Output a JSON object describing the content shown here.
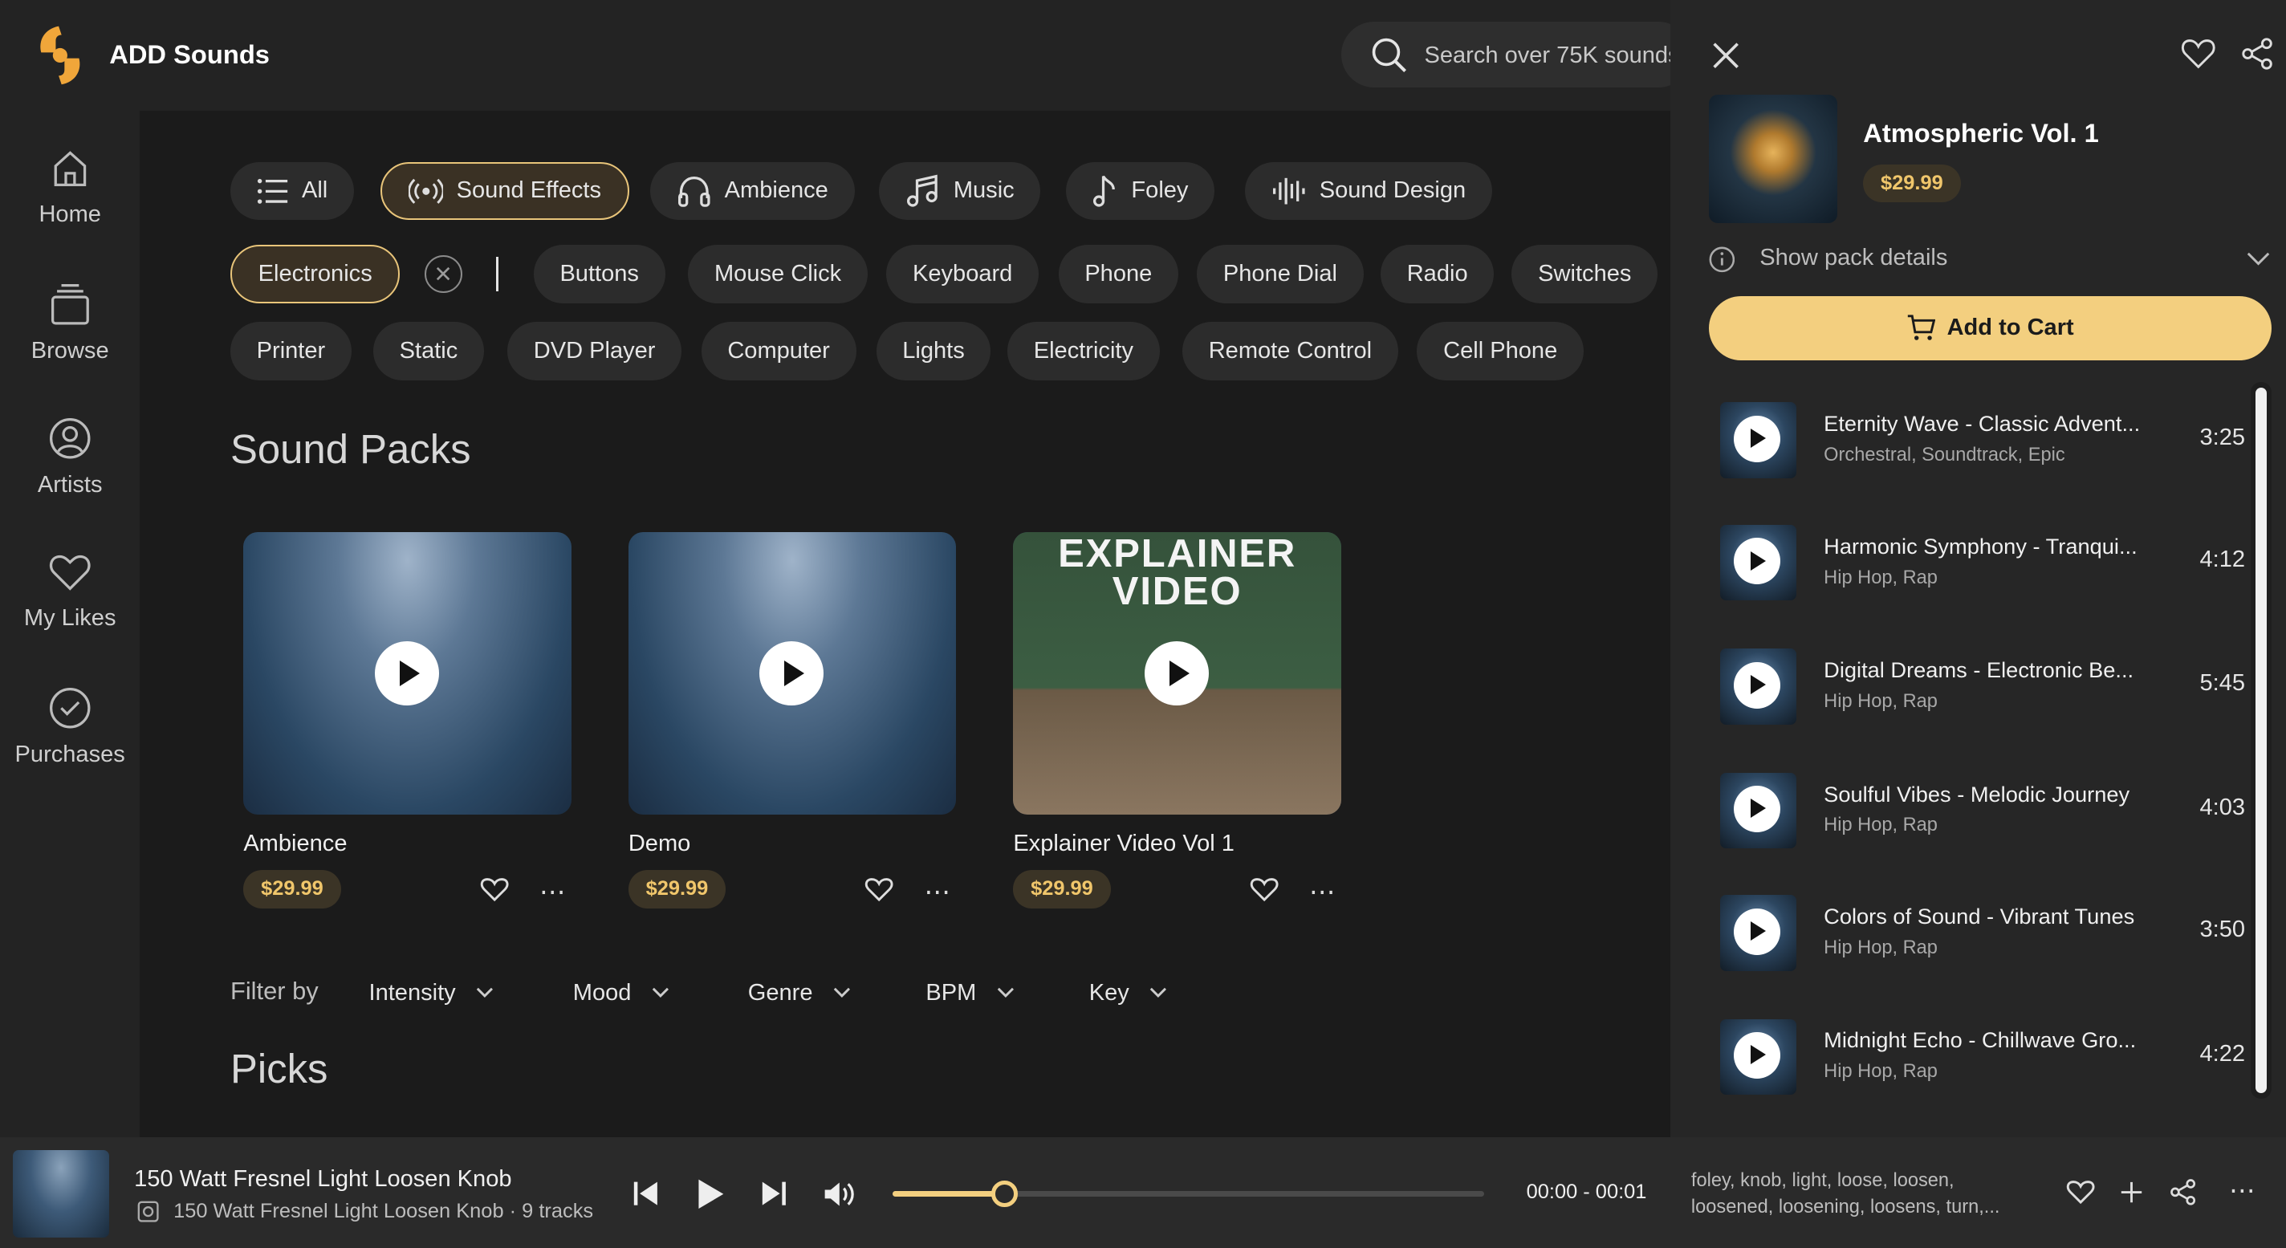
{
  "app": {
    "title": "ADD Sounds"
  },
  "search": {
    "placeholder": "Search over 75K sounds"
  },
  "sidebar": {
    "items": [
      {
        "label": "Home",
        "icon": "home-icon"
      },
      {
        "label": "Browse",
        "icon": "browse-icon"
      },
      {
        "label": "Artists",
        "icon": "user-icon"
      },
      {
        "label": "My Likes",
        "icon": "heart-icon"
      },
      {
        "label": "Purchases",
        "icon": "check-circle-icon"
      }
    ]
  },
  "categories": [
    {
      "label": "All",
      "icon": "list-icon",
      "selected": false
    },
    {
      "label": "Sound Effects",
      "icon": "broadcast-icon",
      "selected": true
    },
    {
      "label": "Ambience",
      "icon": "headphones-icon",
      "selected": false
    },
    {
      "label": "Music",
      "icon": "music-notes-icon",
      "selected": false
    },
    {
      "label": "Foley",
      "icon": "music-note-icon",
      "selected": false
    },
    {
      "label": "Sound Design",
      "icon": "waveform-icon",
      "selected": false
    }
  ],
  "subcategories": {
    "selected": "Electronics",
    "row1": [
      "Buttons",
      "Mouse Click",
      "Keyboard",
      "Phone",
      "Phone Dial",
      "Radio",
      "Switches"
    ],
    "row2": [
      "Printer",
      "Static",
      "DVD Player",
      "Computer",
      "Lights",
      "Electricity",
      "Remote Control",
      "Cell Phone"
    ]
  },
  "sound_packs": {
    "title": "Sound Packs",
    "items": [
      {
        "name": "Ambience",
        "price": "$29.99"
      },
      {
        "name": "Demo",
        "price": "$29.99"
      },
      {
        "name": "Explainer Video Vol 1",
        "price": "$29.99",
        "art_text": "EXPLAINER VIDEO"
      }
    ]
  },
  "filter": {
    "label": "Filter by",
    "options": [
      "Intensity",
      "Mood",
      "Genre",
      "BPM",
      "Key"
    ]
  },
  "picks": {
    "title": "Picks"
  },
  "panel": {
    "pack_title": "Atmospheric Vol. 1",
    "price": "$29.99",
    "details_label": "Show pack details",
    "add_to_cart": "Add to Cart",
    "tracks": [
      {
        "title": "Eternity Wave - Classic Advent...",
        "tags": "Orchestral, Soundtrack, Epic",
        "duration": "3:25"
      },
      {
        "title": "Harmonic Symphony - Tranqui...",
        "tags": "Hip Hop, Rap",
        "duration": "4:12"
      },
      {
        "title": "Digital Dreams - Electronic Be...",
        "tags": "Hip Hop, Rap",
        "duration": "5:45"
      },
      {
        "title": "Soulful Vibes - Melodic Journey",
        "tags": "Hip Hop, Rap",
        "duration": "4:03"
      },
      {
        "title": "Colors of Sound - Vibrant Tunes",
        "tags": "Hip Hop, Rap",
        "duration": "3:50"
      },
      {
        "title": "Midnight Echo - Chillwave Gro...",
        "tags": "Hip Hop, Rap",
        "duration": "4:22"
      }
    ]
  },
  "player": {
    "title": "150 Watt Fresnel Light Loosen Knob",
    "subtitle": "150 Watt Fresnel Light Loosen Knob · 9 tracks",
    "time": "00:00 - 00:01",
    "progress": 0.19,
    "tags": "foley, knob, light, loose, loosen, loosened, loosening, loosens, turn,..."
  },
  "colors": {
    "accent": "#f3cf7f",
    "background": "#1b1b1b",
    "panel": "#262626"
  }
}
